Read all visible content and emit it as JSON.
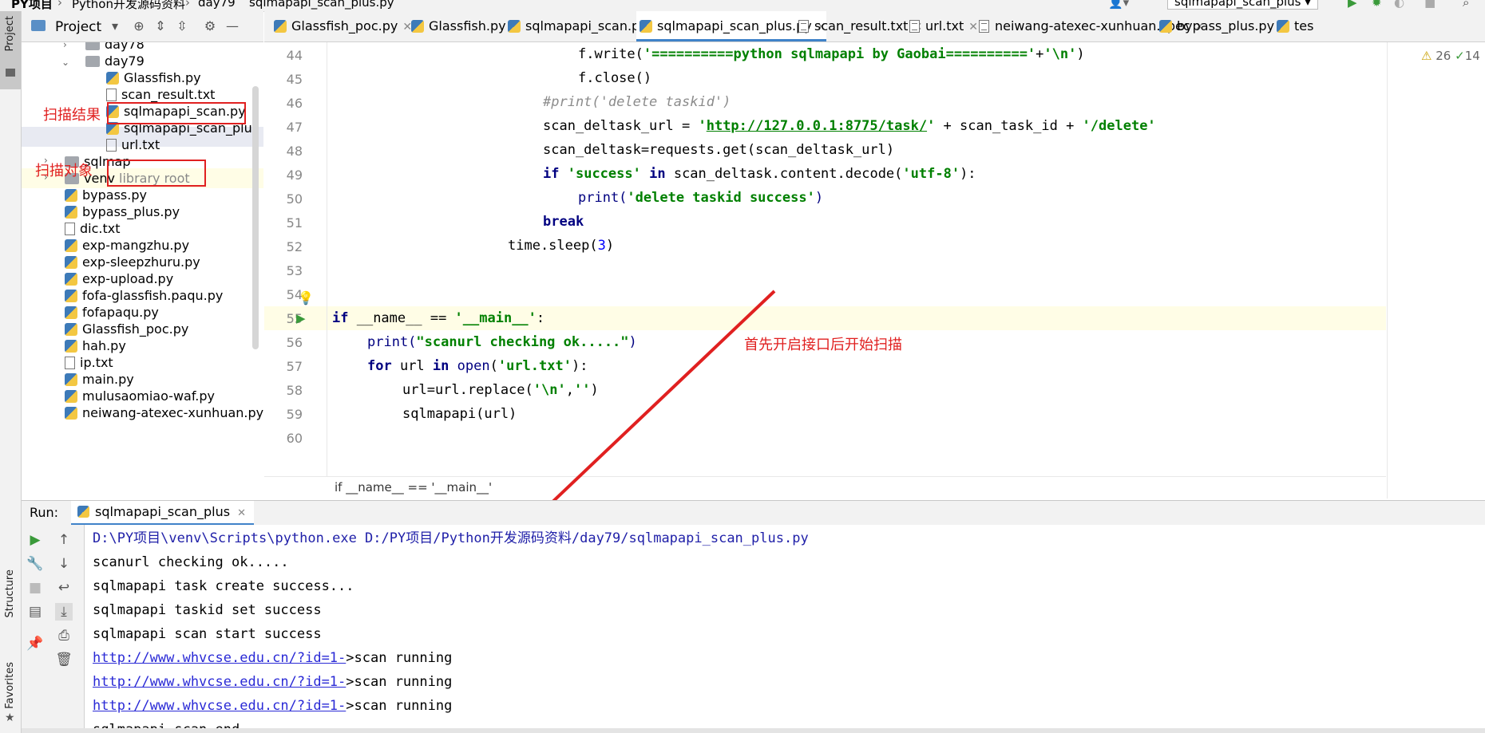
{
  "breadcrumb": {
    "project": "PY项目",
    "folder": "Python开发源码资料",
    "subfolder": "day79",
    "file": "sqlmapapi_scan_plus.py"
  },
  "run_config": {
    "label": "sqlmapapi_scan_plus"
  },
  "project_panel": {
    "title": "Project"
  },
  "side_labels": {
    "project": "Project",
    "structure": "Structure",
    "favorites": "Favorites"
  },
  "tabs": [
    {
      "label": "Glassfish_poc.py",
      "icon": "python-file-icon"
    },
    {
      "label": "Glassfish.py",
      "icon": "python-file-icon"
    },
    {
      "label": "sqlmapapi_scan.py",
      "icon": "python-file-icon"
    },
    {
      "label": "sqlmapapi_scan_plus.py",
      "icon": "python-file-icon",
      "active": true
    },
    {
      "label": "scan_result.txt",
      "icon": "text-file-icon"
    },
    {
      "label": "url.txt",
      "icon": "text-file-icon"
    },
    {
      "label": "neiwang-atexec-xunhuan.spec",
      "icon": "text-file-icon"
    },
    {
      "label": "bypass_plus.py",
      "icon": "python-file-icon"
    },
    {
      "label": "tes",
      "icon": "python-file-icon"
    }
  ],
  "tree": [
    {
      "label": "day78",
      "type": "folder"
    },
    {
      "label": "day79",
      "type": "folder",
      "expanded": true
    },
    {
      "label": "Glassfish.py",
      "type": "py"
    },
    {
      "label": "scan_result.txt",
      "type": "txt"
    },
    {
      "label": "sqlmapapi_scan.py",
      "type": "py"
    },
    {
      "label": "sqlmapapi_scan_plus.py",
      "type": "py"
    },
    {
      "label": "url.txt",
      "type": "txt"
    },
    {
      "label": "sqlmap",
      "type": "folder"
    },
    {
      "label": "venv",
      "type": "folder",
      "suffix": "library root"
    },
    {
      "label": "bypass.py",
      "type": "py"
    },
    {
      "label": "bypass_plus.py",
      "type": "py"
    },
    {
      "label": "dic.txt",
      "type": "txt"
    },
    {
      "label": "exp-mangzhu.py",
      "type": "py"
    },
    {
      "label": "exp-sleepzhuru.py",
      "type": "py"
    },
    {
      "label": "exp-upload.py",
      "type": "py"
    },
    {
      "label": "fofa-glassfish.paqu.py",
      "type": "py"
    },
    {
      "label": "fofapaqu.py",
      "type": "py"
    },
    {
      "label": "Glassfish_poc.py",
      "type": "py"
    },
    {
      "label": "hah.py",
      "type": "py"
    },
    {
      "label": "ip.txt",
      "type": "txt"
    },
    {
      "label": "main.py",
      "type": "py"
    },
    {
      "label": "mulusaomiao-waf.py",
      "type": "py"
    },
    {
      "label": "neiwang-atexec-xunhuan.py",
      "type": "py"
    }
  ],
  "annotations": {
    "scan_result": "扫描结果",
    "scan_target": "扫描对象",
    "editor_note": "首先开启接口后开始扫描"
  },
  "line_numbers": [
    "44",
    "45",
    "46",
    "47",
    "48",
    "49",
    "50",
    "51",
    "52",
    "53",
    "54",
    "55",
    "56",
    "57",
    "58",
    "59",
    "60"
  ],
  "code": {
    "l44": [
      "f.write(",
      "'==========python sqlmapapi by Gaobai=========='",
      "+",
      "'\\n'",
      ")"
    ],
    "l45": "f.close()",
    "l46": "#print('delete taskid')",
    "l47": [
      "scan_deltask_url = ",
      "'",
      "http://127.0.0.1:8775/task/",
      "'",
      " + scan_task_id + ",
      "'/delete'"
    ],
    "l48": "scan_deltask=requests.get(scan_deltask_url)",
    "l49": [
      "if",
      " ",
      "'success'",
      " ",
      "in",
      " scan_deltask.content.decode(",
      "'utf-8'",
      "):"
    ],
    "l50": [
      "print(",
      "'delete taskid success'",
      ")"
    ],
    "l51": "break",
    "l52": [
      "time.sleep(",
      "3",
      ")"
    ],
    "l55": [
      "if",
      " __name__ == ",
      "'__main__'",
      ":"
    ],
    "l56": [
      "print(",
      "\"scanurl checking ok.....\"",
      ")"
    ],
    "l57": [
      "for",
      " url ",
      "in",
      " ",
      "open",
      "(",
      "'url.txt'",
      "):"
    ],
    "l58": [
      "url=url.replace(",
      "'\\n'",
      ",",
      "''",
      ")"
    ],
    "l59": "sqlmapapi(url)"
  },
  "inspection": {
    "warnings": "26",
    "ok": "14"
  },
  "editor_breadcrumb": "if __name__ == '__main__'",
  "run_panel": {
    "label": "Run:",
    "tab": "sqlmapapi_scan_plus"
  },
  "console": {
    "cmd_path1": "D:\\PY项目\\venv\\Scripts\\python.exe D:/PY项目/Python开发源码资料/day79/sqlmapapi_scan_plus.py",
    "lines": [
      "scanurl checking ok.....",
      "sqlmapapi task create success...",
      "sqlmapapi taskid set success",
      "sqlmapapi scan start success"
    ],
    "url": "http://www.whvcse.edu.cn/?id=1-",
    "status": ">scan running",
    "last": "sqlmapapi scan end"
  },
  "colors": {
    "annotation": "#e02020",
    "keyword": "#000080",
    "string": "#008000",
    "active_tab": "#4083c9"
  }
}
